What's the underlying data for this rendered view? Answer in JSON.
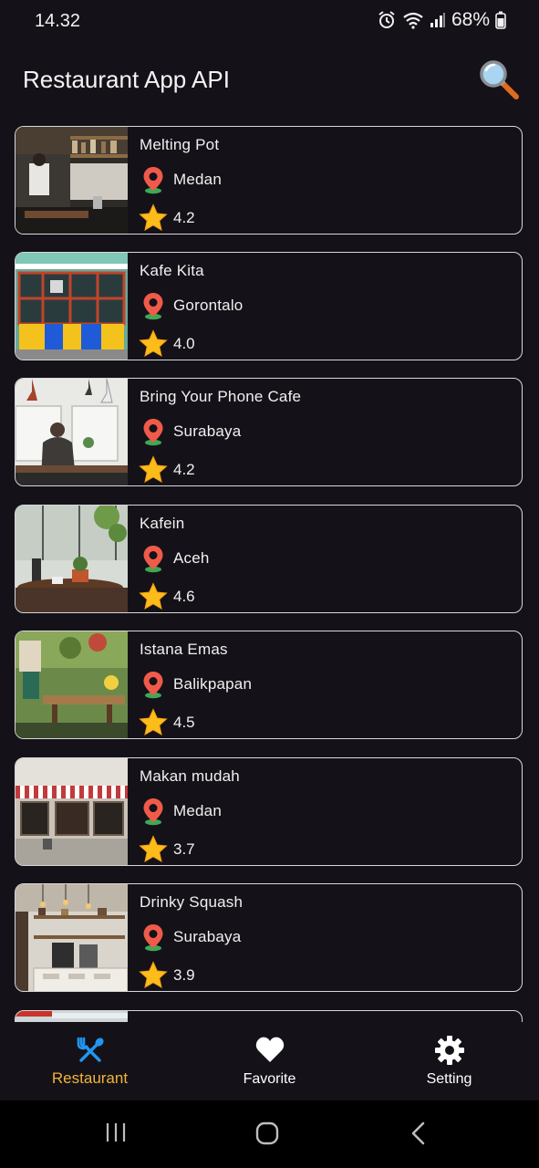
{
  "status": {
    "time": "14.32",
    "battery": "68%"
  },
  "app": {
    "title": "Restaurant App API"
  },
  "restaurants": [
    {
      "name": "Melting Pot",
      "city": "Medan",
      "rating": "4.2"
    },
    {
      "name": "Kafe Kita",
      "city": "Gorontalo",
      "rating": "4.0"
    },
    {
      "name": "Bring Your Phone Cafe",
      "city": "Surabaya",
      "rating": "4.2"
    },
    {
      "name": "Kafein",
      "city": "Aceh",
      "rating": "4.6"
    },
    {
      "name": "Istana Emas",
      "city": "Balikpapan",
      "rating": "4.5"
    },
    {
      "name": "Makan mudah",
      "city": "Medan",
      "rating": "3.7"
    },
    {
      "name": "Drinky Squash",
      "city": "Surabaya",
      "rating": "3.9"
    }
  ],
  "nav": {
    "items": [
      {
        "label": "Restaurant",
        "icon": "fork-spoon-icon",
        "active": true
      },
      {
        "label": "Favorite",
        "icon": "heart-icon",
        "active": false
      },
      {
        "label": "Setting",
        "icon": "gear-icon",
        "active": false
      }
    ]
  },
  "colors": {
    "background": "#141218",
    "accent": "#f2b33a",
    "active_icon": "#2196f3",
    "card_border": "#d8d8d8"
  }
}
